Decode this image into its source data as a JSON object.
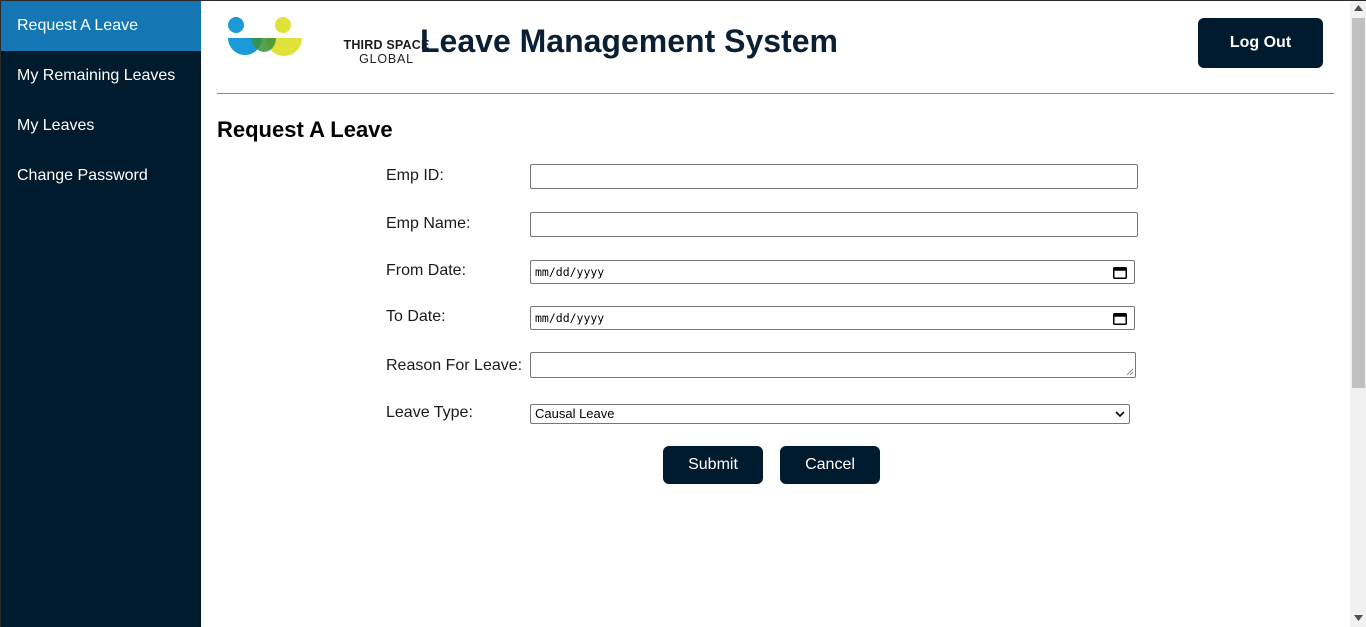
{
  "sidebar": {
    "items": [
      {
        "label": "Request A Leave"
      },
      {
        "label": "My Remaining Leaves"
      },
      {
        "label": "My Leaves"
      },
      {
        "label": "Change Password"
      }
    ]
  },
  "header": {
    "logo_line1": "THIRD SPACE",
    "logo_line2": "GLOBAL",
    "title": "Leave Management System",
    "logout_label": "Log Out"
  },
  "page": {
    "title": "Request A Leave"
  },
  "form": {
    "emp_id": {
      "label": "Emp ID:",
      "value": ""
    },
    "emp_name": {
      "label": "Emp Name:",
      "value": ""
    },
    "from_date": {
      "label": "From Date:",
      "placeholder": "mm/dd/yyyy"
    },
    "to_date": {
      "label": "To Date:",
      "placeholder": "mm/dd/yyyy"
    },
    "reason": {
      "label": "Reason For Leave:",
      "value": ""
    },
    "leave_type": {
      "label": "Leave Type:",
      "selected": "Causal Leave"
    }
  },
  "actions": {
    "submit_label": "Submit",
    "cancel_label": "Cancel"
  },
  "colors": {
    "sidebar_bg": "#001b2e",
    "sidebar_active": "#1477b4",
    "button_bg": "#001b2e",
    "logo_blue": "#1a9ad6",
    "logo_green": "#3c8f3a",
    "logo_yellow": "#dfe23a"
  },
  "icons": {
    "date_picker": "calendar-icon",
    "select_arrow": "chevron-down-icon"
  }
}
